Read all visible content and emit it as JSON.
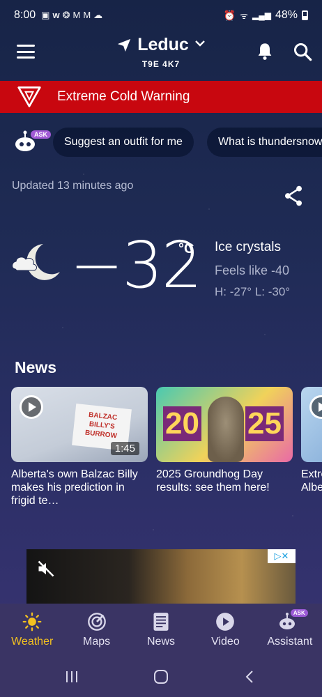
{
  "status_bar": {
    "time": "8:00",
    "notification_icons": [
      "cast-icon",
      "w-icon",
      "game-icon",
      "gmail-icon",
      "gmail-icon",
      "cloud-icon"
    ],
    "battery": "48%"
  },
  "header": {
    "city": "Leduc",
    "postal_code": "T9E 4K7"
  },
  "alert": {
    "text": "Extreme Cold Warning",
    "color": "#c8070f"
  },
  "assistant_chips": {
    "badge": "ASK",
    "items": [
      {
        "label": "Suggest an outfit for me"
      },
      {
        "label": "What is thundersnow?"
      }
    ]
  },
  "current": {
    "updated": "Updated 13 minutes ago",
    "temperature": "−32",
    "unit": "°C",
    "condition": "Ice crystals",
    "feels_like": "Feels like -40",
    "hi_lo": "H: -27° L: -30°",
    "icon": "night-partly-cloudy-icon"
  },
  "news": {
    "title": "News",
    "cards": [
      {
        "title": "Alberta's own Balzac Billy makes his prediction in frigid te…",
        "duration": "1:45",
        "sign_text": "BALZAC BILLY'S BURROW"
      },
      {
        "title": "2025 Groundhog Day results: see them here!",
        "year_left": "20",
        "year_right": "25"
      },
      {
        "title": "Extreme cold straining Alberta's power grid"
      }
    ]
  },
  "ad": {
    "adchoices": "▷✕"
  },
  "bottom_nav": {
    "items": [
      {
        "label": "Weather",
        "active": true
      },
      {
        "label": "Maps"
      },
      {
        "label": "News"
      },
      {
        "label": "Video"
      },
      {
        "label": "Assistant",
        "badge": "ASK"
      }
    ],
    "active_color": "#f2c020"
  }
}
